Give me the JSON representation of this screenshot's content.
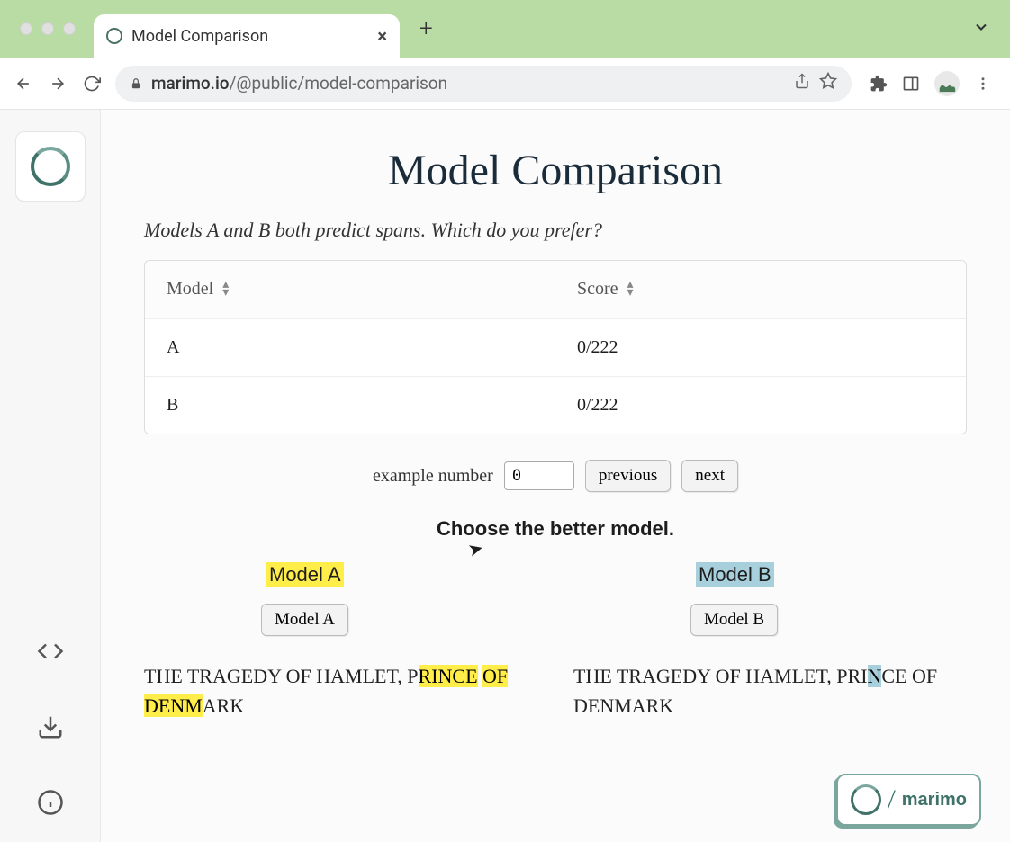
{
  "browser": {
    "tab_title": "Model Comparison",
    "url_domain": "marimo.io",
    "url_path": "/@public/model-comparison"
  },
  "page": {
    "title": "Model Comparison",
    "subtitle": "Models A and B both predict spans. Which do you prefer?"
  },
  "table": {
    "col_model": "Model",
    "col_score": "Score",
    "rows": [
      {
        "model": "A",
        "score": "0/222"
      },
      {
        "model": "B",
        "score": "0/222"
      }
    ]
  },
  "nav": {
    "label": "example number",
    "value": "0",
    "prev": "previous",
    "next": "next"
  },
  "choose": {
    "heading": "Choose the better model.",
    "col_a_label": "Model A",
    "col_b_label": "Model B",
    "btn_a": "Model A",
    "btn_b": "Model B"
  },
  "passage": {
    "a_pre": "THE TRAGEDY OF HAMLET, P",
    "a_hl1": "RINCE",
    "a_mid": " ",
    "a_hl2": "OF DENM",
    "a_post": "ARK",
    "b_pre": "THE TRAGEDY OF HAMLET, PRI",
    "b_hl1": "N",
    "b_post": "CE OF DENMARK"
  },
  "badge": {
    "text": "marimo"
  }
}
